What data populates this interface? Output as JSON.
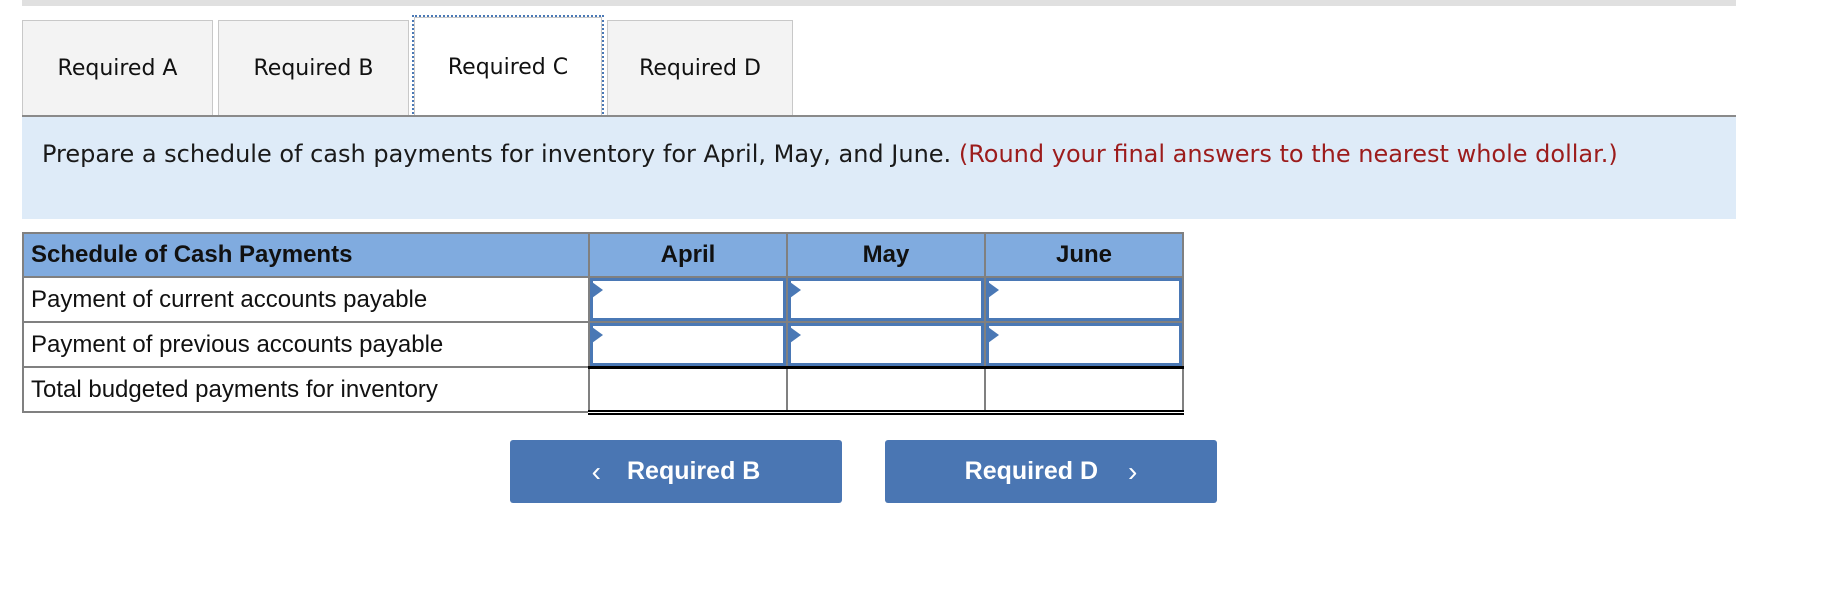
{
  "tabs": [
    {
      "label": "Required A",
      "active": false
    },
    {
      "label": "Required B",
      "active": false
    },
    {
      "label": "Required C",
      "active": true
    },
    {
      "label": "Required D",
      "active": false
    }
  ],
  "instruction": {
    "text": "Prepare a schedule of cash payments for inventory for April, May, and June.",
    "note": "(Round your final answers to the nearest whole dollar.)"
  },
  "table": {
    "header": {
      "label": "Schedule of Cash Payments",
      "columns": [
        "April",
        "May",
        "June"
      ]
    },
    "rows": [
      {
        "label": "Payment of current accounts payable",
        "values": [
          "",
          "",
          ""
        ]
      },
      {
        "label": "Payment of previous accounts payable",
        "values": [
          "",
          "",
          ""
        ]
      },
      {
        "label": "Total budgeted payments for inventory",
        "values": [
          "",
          "",
          ""
        ]
      }
    ]
  },
  "nav": {
    "prev_label": "Required B",
    "next_label": "Required D",
    "prev_icon": "chevron-left-icon",
    "next_icon": "chevron-right-icon"
  },
  "colors": {
    "accent": "#4a76b3",
    "header_bg": "#80abdf",
    "instruction_bg": "#deebf8",
    "note_text": "#9c1c1c"
  }
}
